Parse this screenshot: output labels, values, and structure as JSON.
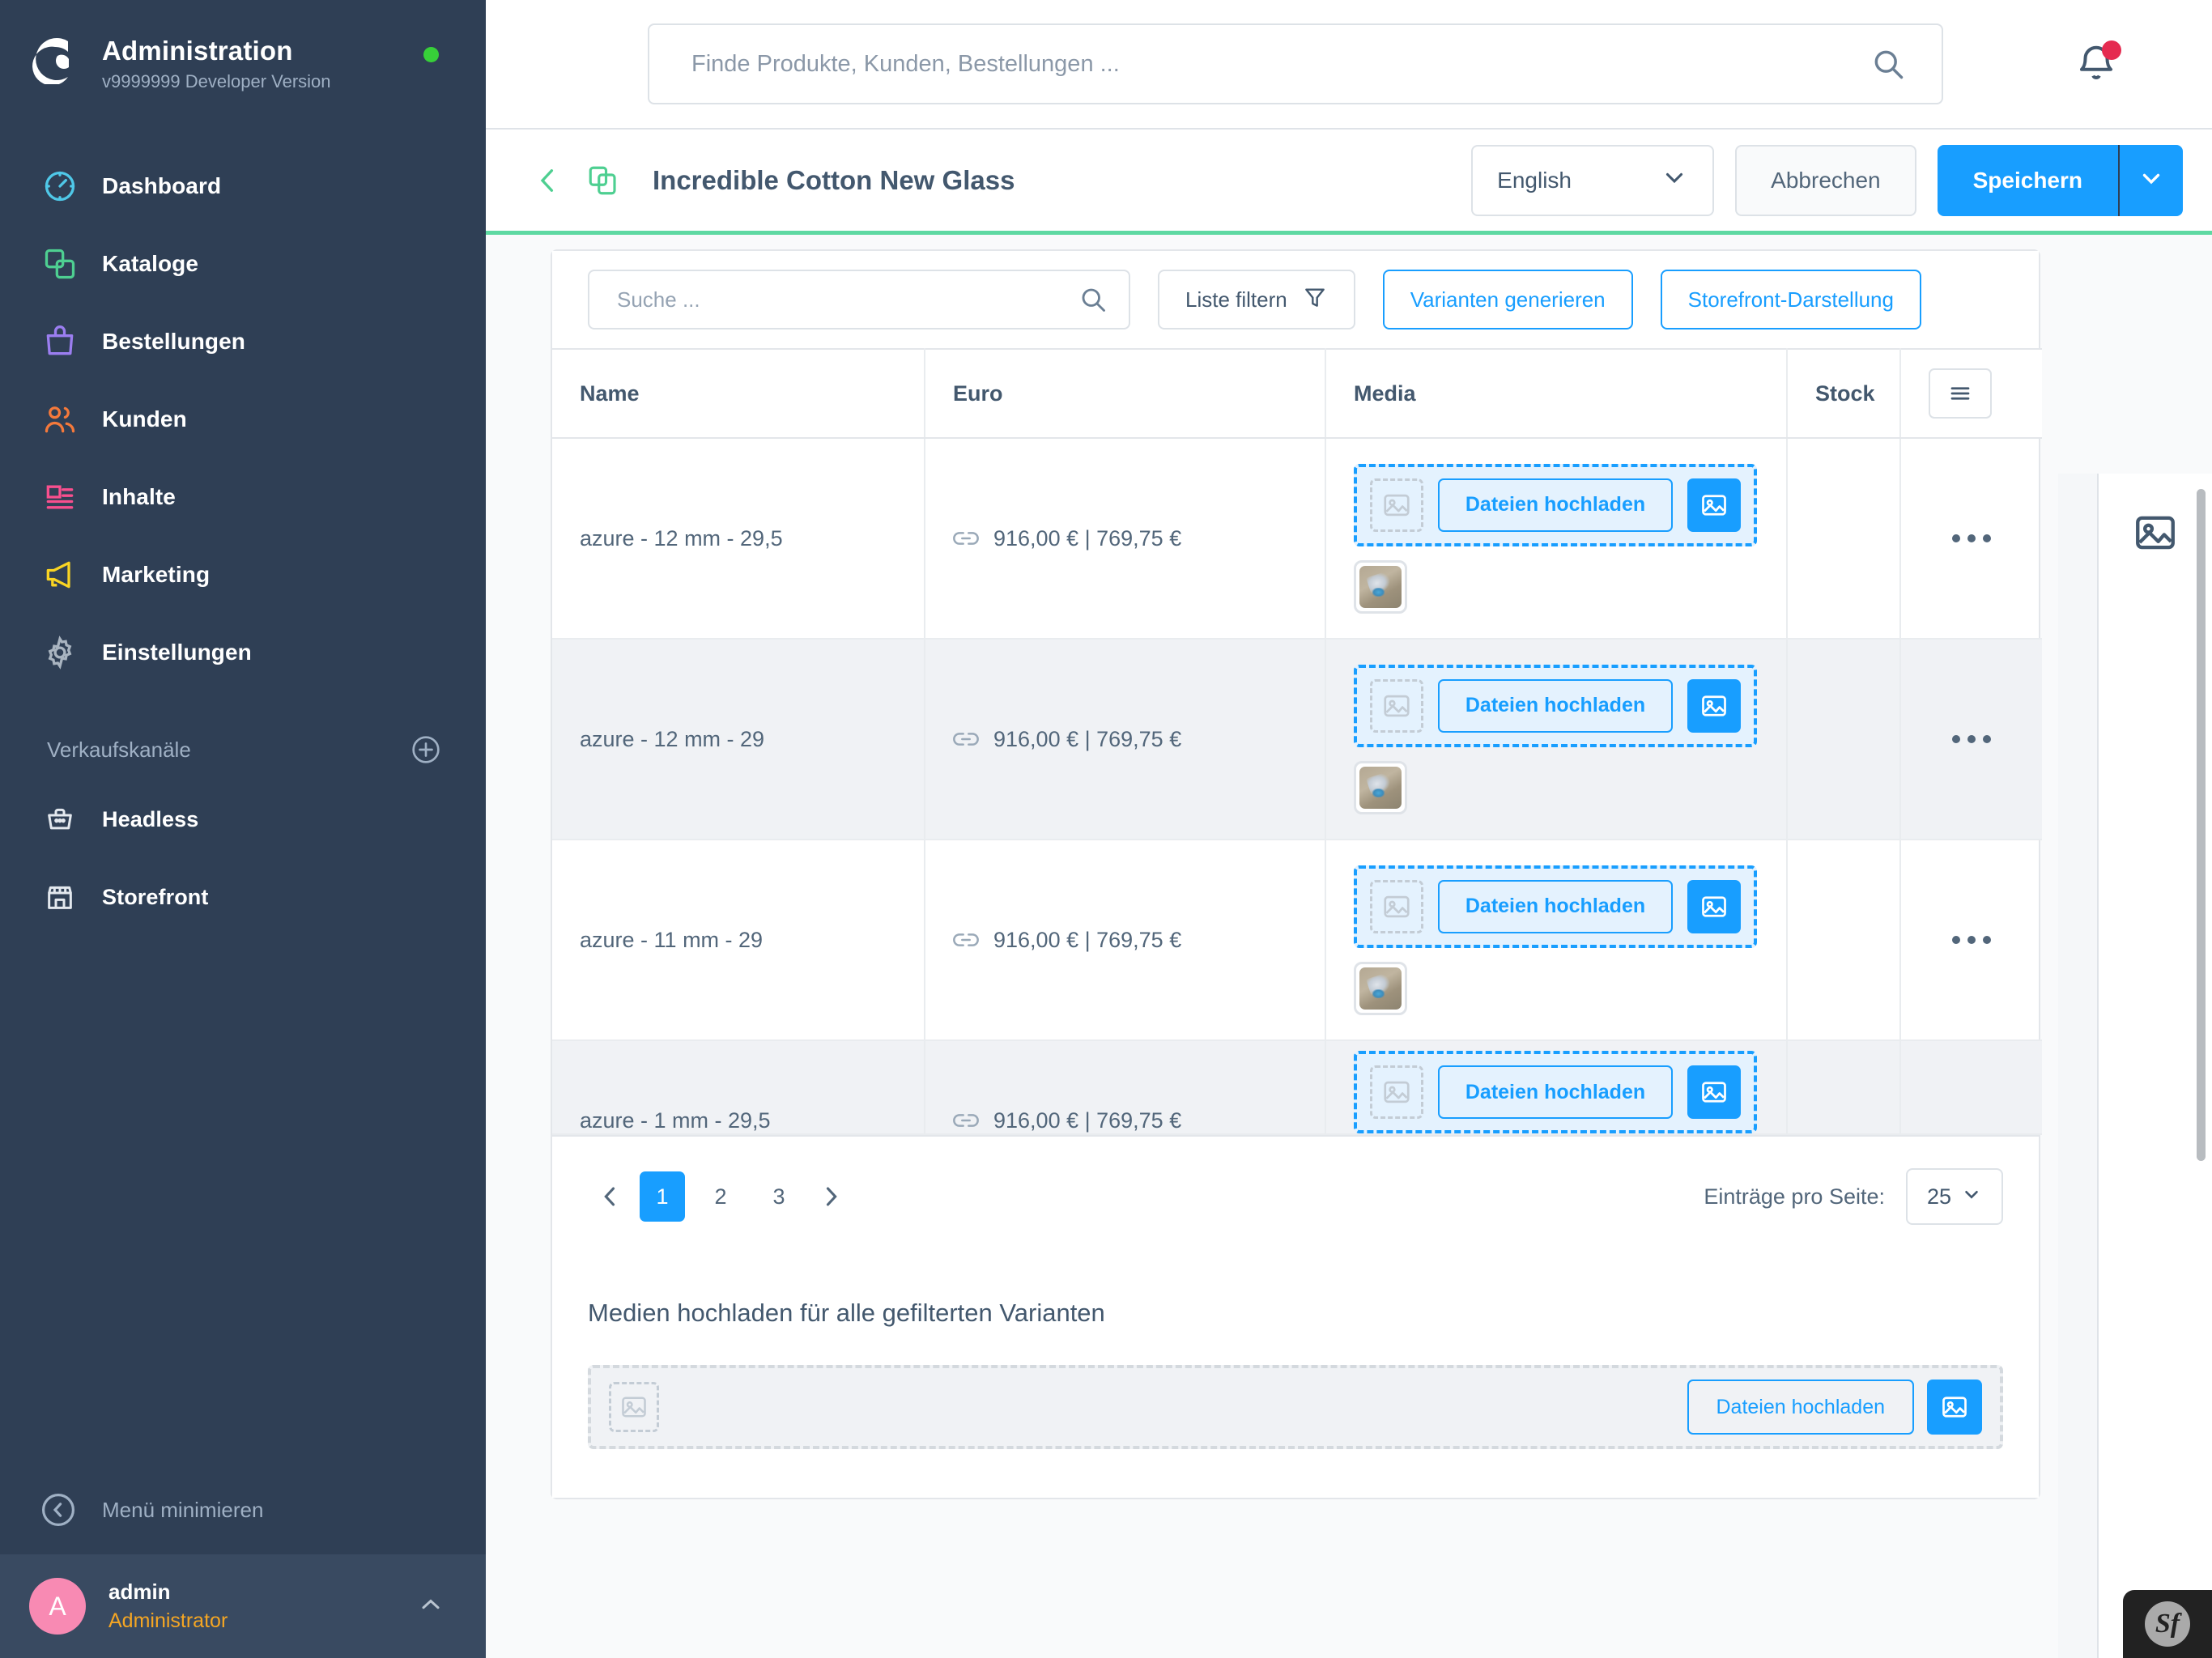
{
  "sidebar": {
    "brand": {
      "title": "Administration",
      "version": "v9999999 Developer Version"
    },
    "nav": [
      {
        "label": "Dashboard",
        "icon": "dashboard-icon",
        "color": "#4fc8e8"
      },
      {
        "label": "Kataloge",
        "icon": "catalog-icon",
        "color": "#4ecf91"
      },
      {
        "label": "Bestellungen",
        "icon": "orders-bag-icon",
        "color": "#9b7ef0"
      },
      {
        "label": "Kunden",
        "icon": "customers-icon",
        "color": "#f5793b"
      },
      {
        "label": "Inhalte",
        "icon": "content-icon",
        "color": "#f94f8e"
      },
      {
        "label": "Marketing",
        "icon": "megaphone-icon",
        "color": "#f9d423"
      },
      {
        "label": "Einstellungen",
        "icon": "gear-icon",
        "color": "#a9b4c0"
      }
    ],
    "sales_channels_title": "Verkaufskanäle",
    "channels": [
      {
        "label": "Headless",
        "icon": "basket-icon"
      },
      {
        "label": "Storefront",
        "icon": "store-icon"
      }
    ],
    "minimize_label": "Menü minimieren",
    "user": {
      "initial": "A",
      "name": "admin",
      "role": "Administrator"
    }
  },
  "topbar": {
    "search_placeholder": "Finde Produkte, Kunden, Bestellungen ...",
    "search_value": "",
    "notification_has_badge": true
  },
  "smartbar": {
    "title": "Incredible Cotton New Glass",
    "language": "English",
    "cancel_label": "Abbrechen",
    "save_label": "Speichern"
  },
  "toolbar": {
    "search_placeholder": "Suche ...",
    "search_value": "",
    "filter_label": "Liste filtern",
    "generate_label": "Varianten generieren",
    "storefront_label": "Storefront-Darstellung"
  },
  "table": {
    "columns": [
      "Name",
      "Euro",
      "Media",
      "Stock"
    ],
    "upload_label": "Dateien hochladen",
    "rows": [
      {
        "name": "azure  -  12 mm  -  29,5",
        "price": "916,00 € | 769,75 €",
        "stock": "",
        "has_thumb": true
      },
      {
        "name": "azure  -  12 mm  -  29",
        "price": "916,00 € | 769,75 €",
        "stock": "",
        "has_thumb": true
      },
      {
        "name": "azure  -  11 mm  -  29",
        "price": "916,00 € | 769,75 €",
        "stock": "",
        "has_thumb": true
      },
      {
        "name": "azure  -  1 mm  -  29,5",
        "price": "916,00 € | 769,75 €",
        "stock": "",
        "has_thumb": false
      }
    ]
  },
  "pagination": {
    "pages": [
      "1",
      "2",
      "3"
    ],
    "current": "1",
    "per_page_label": "Einträge pro Seite:",
    "per_page_value": "25"
  },
  "bulk_upload": {
    "title": "Medien hochladen für alle gefilterten Varianten",
    "button_label": "Dateien hochladen"
  },
  "footer": {
    "profiler_label": "Sf"
  },
  "colors": {
    "accent_blue": "#189eff",
    "brand_green": "#5ed9a2",
    "sidebar_bg": "#2f3f55",
    "badge_red": "#e52b50",
    "status_green": "#37d039",
    "avatar_pink": "#f88ab3",
    "role_orange": "#f5a623"
  }
}
